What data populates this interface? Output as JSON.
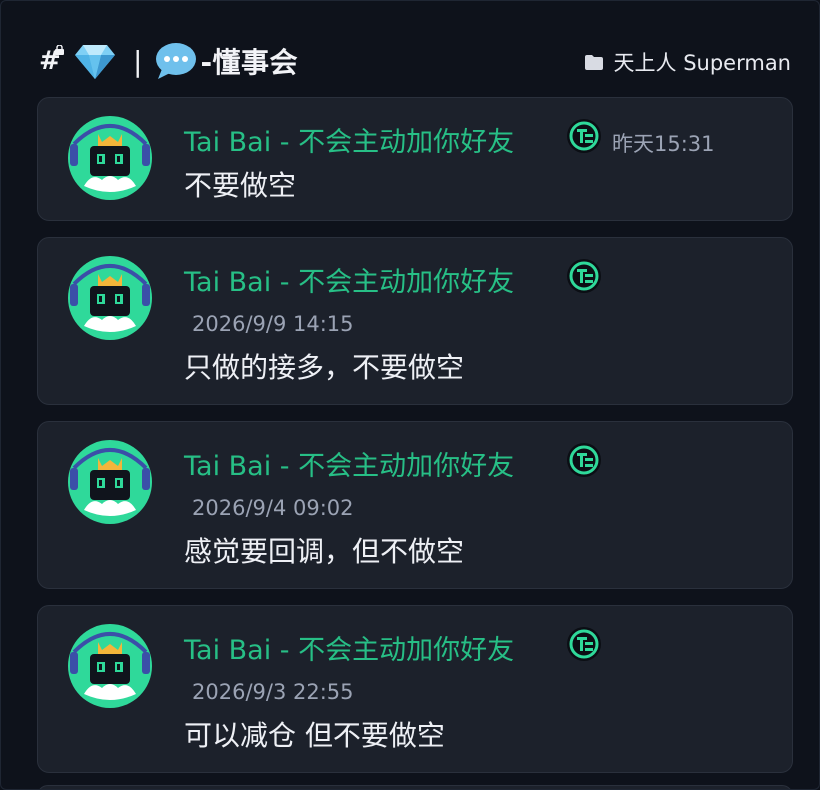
{
  "header": {
    "hash_symbol": "#",
    "separator": "|",
    "channel_name": "-懂事会",
    "server_name": "天上人 Superman"
  },
  "messages": [
    {
      "author": "Tai Bai - 不会主动加你好友",
      "time": "昨天15:31",
      "text": "不要做空"
    },
    {
      "author": "Tai Bai - 不会主动加你好友",
      "time": "2026/9/9 14:15",
      "text": "只做的接多，不要做空"
    },
    {
      "author": "Tai Bai - 不会主动加你好友",
      "time": "2026/9/4 09:02",
      "text": "感觉要回调，但不做空"
    },
    {
      "author": "Tai Bai - 不会主动加你好友",
      "time": "2026/9/3 22:55",
      "text": "可以减仓 但不要做空"
    }
  ],
  "colors": {
    "background": "#0e121b",
    "card": "#1c212b",
    "author_green": "#27bf86",
    "timestamp": "#9ba3b4"
  }
}
